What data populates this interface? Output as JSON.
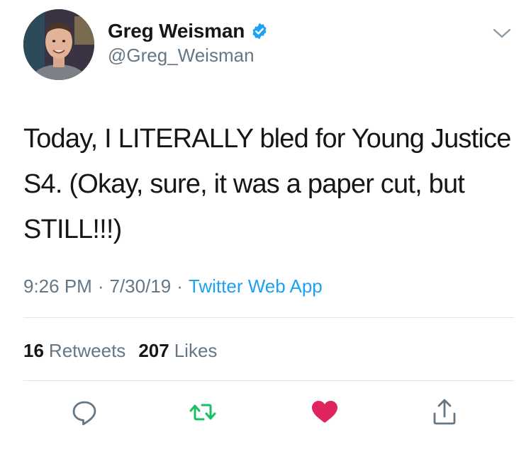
{
  "author": {
    "display_name": "Greg Weisman",
    "handle": "@Greg_Weisman",
    "verified_icon": "verified-badge-icon"
  },
  "tweet": {
    "text": "Today, I LITERALLY bled for Young Justice S4.  (Okay, sure, it was a paper cut, but STILL!!!)",
    "time": "9:26 PM",
    "date": "7/30/19",
    "separator": "·",
    "source": "Twitter Web App"
  },
  "stats": {
    "retweets_count": "16",
    "retweets_label": "Retweets",
    "likes_count": "207",
    "likes_label": "Likes"
  },
  "actions": {
    "reply_icon": "reply-icon",
    "retweet_icon": "retweet-icon",
    "like_icon": "heart-icon",
    "share_icon": "share-icon",
    "liked": true
  },
  "colors": {
    "text": "#14171a",
    "secondary": "#657786",
    "link": "#1da1f2",
    "retweet_green": "#17bf63",
    "like_red": "#e0245e"
  }
}
